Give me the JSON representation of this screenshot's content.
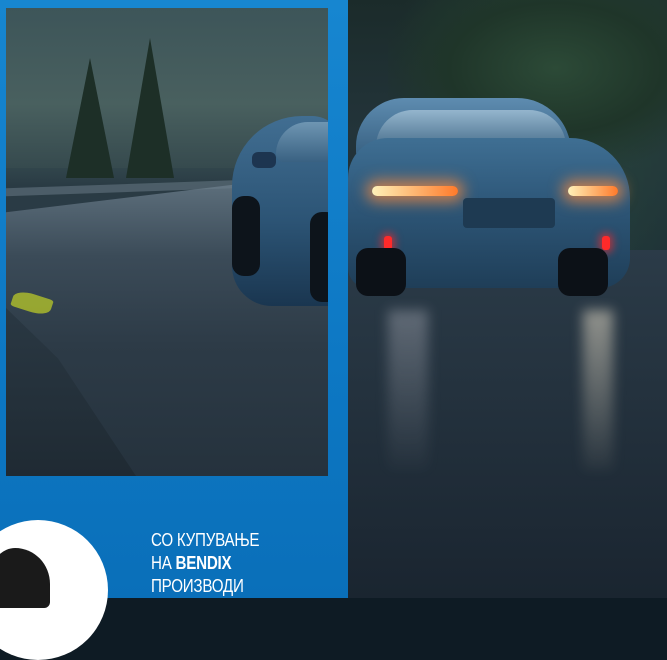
{
  "promo": {
    "line1": "СО КУПУВАЊЕ",
    "line2_prefix": "НА",
    "line2_brand": "BENDIX",
    "line3": "ПРОИЗВОДИ"
  },
  "colors": {
    "panel_blue": "#0d78c4",
    "text": "#ffffff"
  },
  "images": {
    "panel_photo": "car-on-wet-mountain-road-side-view",
    "main_photo": "car-rear-view-tail-lights-wet-road"
  }
}
